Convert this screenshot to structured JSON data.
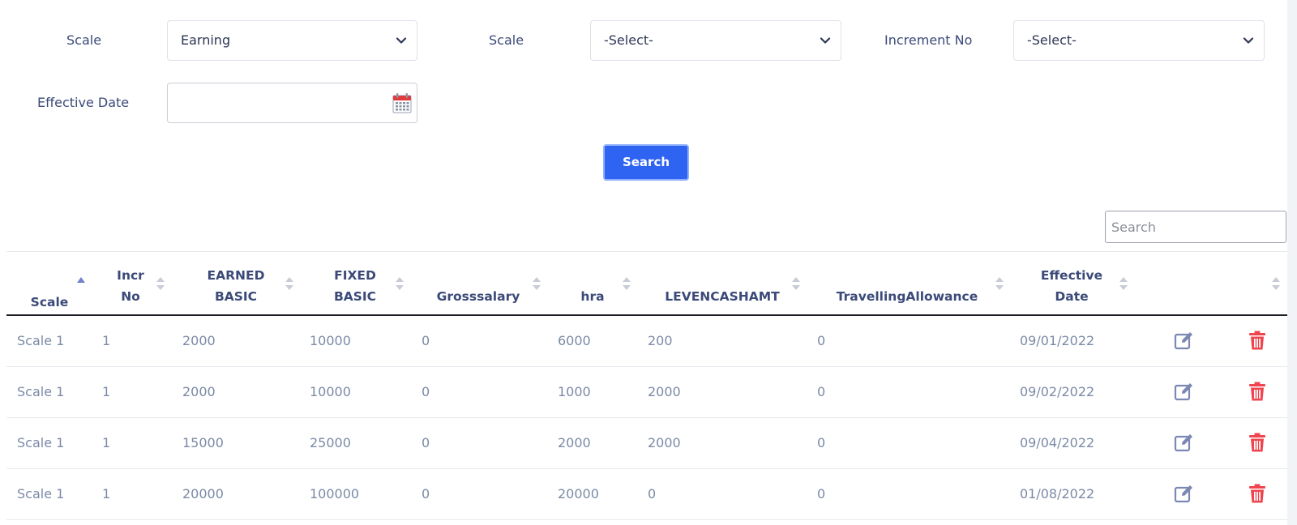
{
  "filters": {
    "scale1_label": "Scale",
    "scale1_value": "Earning",
    "scale2_label": "Scale",
    "scale2_value": "-Select-",
    "increment_label": "Increment No",
    "increment_value": "-Select-",
    "effective_date_label": "Effective Date",
    "effective_date_value": "",
    "search_button": "Search"
  },
  "table": {
    "search_placeholder": "Search",
    "headers": [
      {
        "line1": "",
        "line2": "Scale"
      },
      {
        "line1": "Incr",
        "line2": "No"
      },
      {
        "line1": "EARNED",
        "line2": "BASIC"
      },
      {
        "line1": "FIXED",
        "line2": "BASIC"
      },
      {
        "line1": "",
        "line2": "Grosssalary"
      },
      {
        "line1": "",
        "line2": "hra"
      },
      {
        "line1": "",
        "line2": "LEVENCASHAMT"
      },
      {
        "line1": "",
        "line2": "TravellingAllowance"
      },
      {
        "line1": "Effective",
        "line2": "Date"
      }
    ],
    "rows": [
      [
        "Scale 1",
        "1",
        "2000",
        "10000",
        "0",
        "6000",
        "200",
        "0",
        "09/01/2022"
      ],
      [
        "Scale 1",
        "1",
        "2000",
        "10000",
        "0",
        "1000",
        "2000",
        "0",
        "09/02/2022"
      ],
      [
        "Scale 1",
        "1",
        "15000",
        "25000",
        "0",
        "2000",
        "2000",
        "0",
        "09/04/2022"
      ],
      [
        "Scale 1",
        "1",
        "20000",
        "100000",
        "0",
        "20000",
        "0",
        "0",
        "01/08/2022"
      ]
    ]
  },
  "icons": {
    "edit": "edit-icon",
    "delete": "trash-icon",
    "calendar": "calendar-icon",
    "dropdown": "chevron-down-icon",
    "sort": "sort-icon"
  },
  "colors": {
    "accent": "#2f63f2",
    "label": "#3b4a78",
    "cell_text": "#7b8aa6",
    "edit_icon": "#7b88b3",
    "delete_icon": "#f0444e",
    "sort_active": "#7480c9",
    "sort_inactive": "#c9ccd6"
  }
}
